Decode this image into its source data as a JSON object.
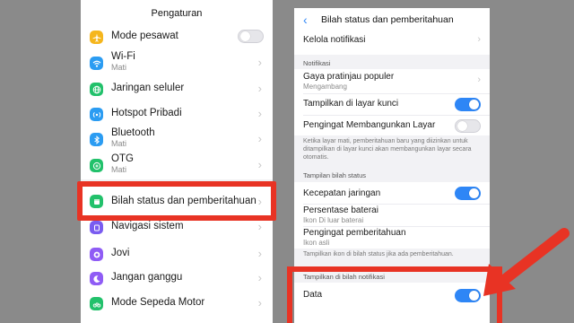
{
  "left": {
    "title": "Pengaturan",
    "items": [
      {
        "label": "Mode pesawat",
        "sub": "",
        "icon": "airplane-icon",
        "color": "#f5b61d"
      },
      {
        "label": "Wi-Fi",
        "sub": "Mati",
        "icon": "wifi-icon",
        "color": "#2b9cf2"
      },
      {
        "label": "Jaringan seluler",
        "sub": "",
        "icon": "globe-icon",
        "color": "#22c16b"
      },
      {
        "label": "Hotspot Pribadi",
        "sub": "",
        "icon": "hotspot-icon",
        "color": "#2b9cf2"
      },
      {
        "label": "Bluetooth",
        "sub": "Mati",
        "icon": "bluetooth-icon",
        "color": "#2b9cf2"
      },
      {
        "label": "OTG",
        "sub": "Mati",
        "icon": "otg-icon",
        "color": "#22c16b"
      },
      {
        "label": "Bilah status dan pemberitahuan",
        "sub": "",
        "icon": "statusbar-icon",
        "color": "#22c16b"
      },
      {
        "label": "Navigasi sistem",
        "sub": "",
        "icon": "navigation-icon",
        "color": "#7a5cf0"
      },
      {
        "label": "Jovi",
        "sub": "",
        "icon": "jovi-icon",
        "color": "#8f5cf5"
      },
      {
        "label": "Jangan ganggu",
        "sub": "",
        "icon": "moon-icon",
        "color": "#8f5cf5"
      },
      {
        "label": "Mode Sepeda Motor",
        "sub": "",
        "icon": "motorcycle-icon",
        "color": "#22c16b"
      }
    ]
  },
  "right": {
    "title": "Bilah status dan pemberitahuan",
    "kelola": "Kelola notifikasi",
    "section_notifikasi": "Notifikasi",
    "gaya_label": "Gaya pratinjau populer",
    "gaya_sub": "Mengambang",
    "tampilkan_label": "Tampilkan di layar kunci",
    "pengingat_label": "Pengingat Membangunkan Layar",
    "pengingat_note": "Ketika layar mati, pemberitahuan baru yang diizinkan untuk ditampilkan di layar kunci akan membangunkan layar secara otomatis.",
    "section_status": "Tampilan bilah status",
    "kecepatan_label": "Kecepatan jaringan",
    "persentase_label": "Persentase baterai",
    "persentase_sub": "Ikon Di luar baterai",
    "pengingat2_label": "Pengingat pemberitahuan",
    "pengingat2_sub": "Ikon asli",
    "status_note": "Tampilkan ikon di bilah status jika ada pemberitahuan.",
    "section_bilah": "Tampilkan di bilah notifikasi",
    "data_label": "Data"
  },
  "colors": {
    "accent": "#2e86f6",
    "highlight": "#e83324"
  }
}
